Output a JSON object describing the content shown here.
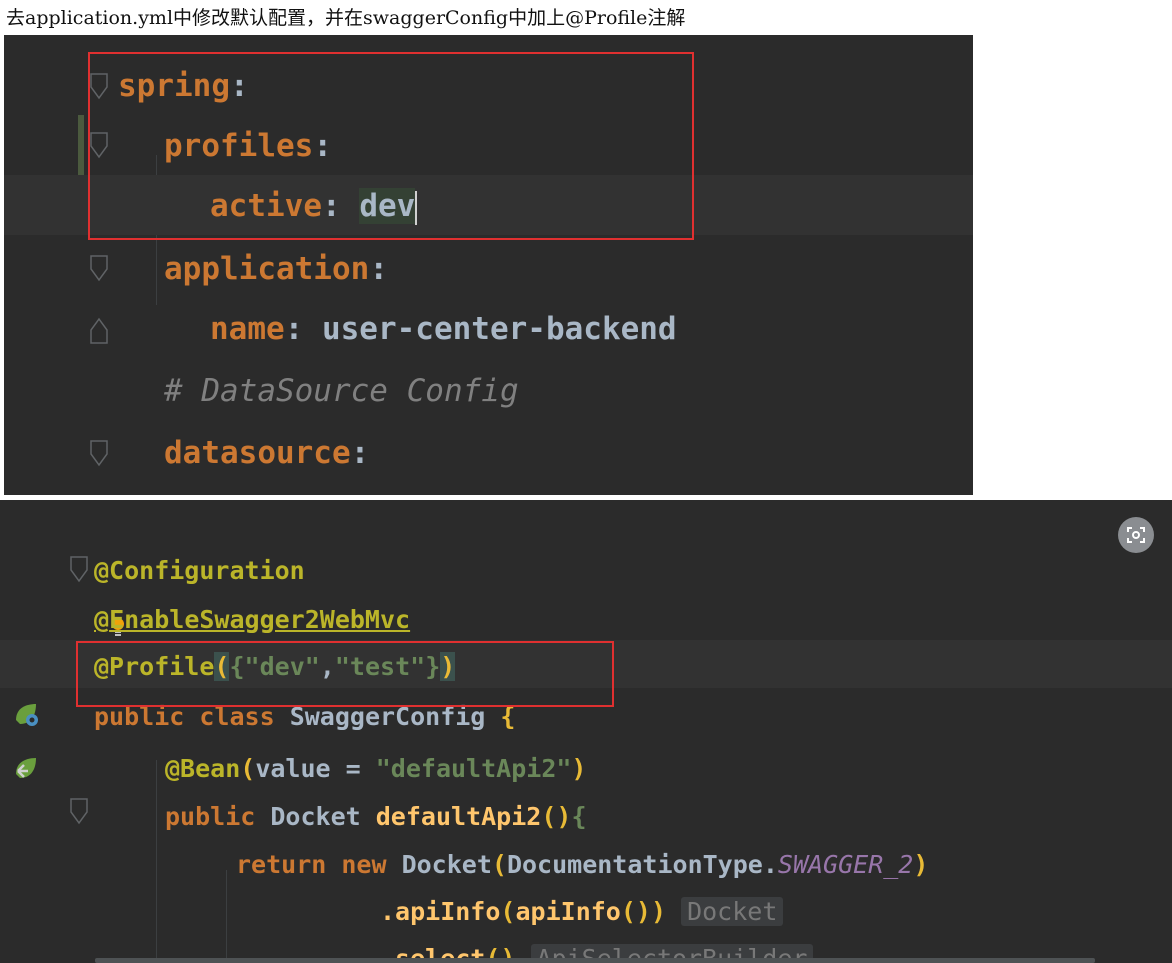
{
  "caption": "去application.yml中修改默认配置，并在swaggerConfig中加上@Profile注解",
  "yaml_editor": {
    "line1_key": "spring",
    "line2_key": "profiles",
    "line3_key": "active",
    "line3_value": "dev",
    "line4_key": "application",
    "line5_key": "name",
    "line5_value": "user-center-backend",
    "line6_comment": "# DataSource Config",
    "line7_key": "datasource"
  },
  "java_editor": {
    "ann_configuration": "@Configuration",
    "ann_enable_prefix": "@",
    "ann_enable_rest": "EnableSwagger2WebMvc",
    "ann_profile": "@Profile",
    "profile_arg1": "\"dev\"",
    "profile_arg2": "\"test\"",
    "class_kw": "public class",
    "class_name": "SwaggerConfig",
    "bean_ann": "@Bean",
    "bean_param": "value",
    "bean_value": "\"defaultApi2\"",
    "method_kw": "public",
    "method_type": "Docket",
    "method_name": "defaultApi2",
    "return_kw": "return new",
    "return_type": "Docket",
    "doc_type": "DocumentationType",
    "doc_const": "SWAGGER_2",
    "apiinfo_call": ".apiInfo",
    "apiinfo_inner": "apiInfo",
    "apiinfo_hint": "Docket",
    "select_call": ".select",
    "select_hint": "ApiSelectorBuilder"
  }
}
